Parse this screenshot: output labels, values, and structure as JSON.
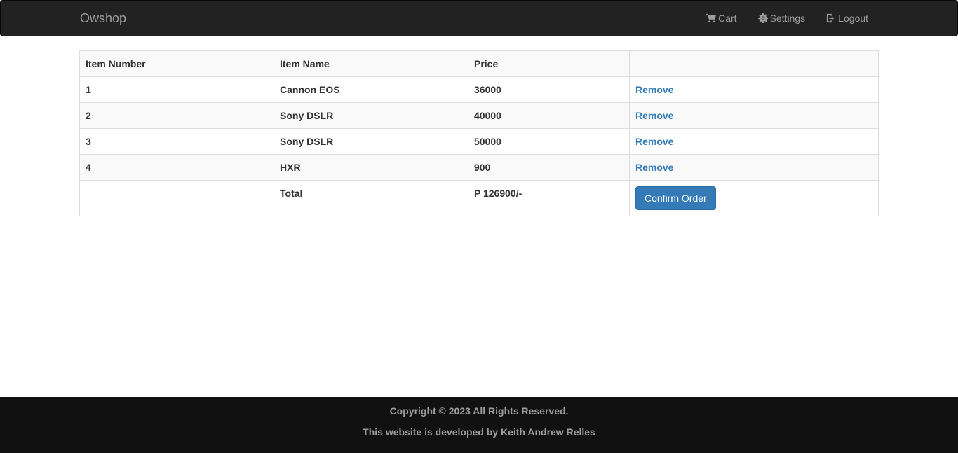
{
  "navbar": {
    "brand": "Owshop",
    "links": [
      {
        "label": "Cart",
        "icon": "cart-icon"
      },
      {
        "label": "Settings",
        "icon": "gear-icon"
      },
      {
        "label": "Logout",
        "icon": "logout-icon"
      }
    ]
  },
  "table": {
    "headers": [
      "Item Number",
      "Item Name",
      "Price",
      ""
    ],
    "rows": [
      {
        "number": "1",
        "name": "Cannon EOS",
        "price": "36000",
        "action": "Remove"
      },
      {
        "number": "2",
        "name": "Sony DSLR",
        "price": "40000",
        "action": "Remove"
      },
      {
        "number": "3",
        "name": "Sony DSLR",
        "price": "50000",
        "action": "Remove"
      },
      {
        "number": "4",
        "name": "HXR",
        "price": "900",
        "action": "Remove"
      }
    ],
    "total": {
      "label": "Total",
      "value": "P 126900/-",
      "button": "Confirm Order"
    }
  },
  "footer": {
    "copyright": "Copyright © 2023 All Rights Reserved.",
    "developer": "This website is developed by Keith Andrew Relles"
  },
  "colors": {
    "navbar_bg": "#222222",
    "footer_bg": "#111111",
    "link": "#337ab7",
    "button": "#337ab7"
  }
}
